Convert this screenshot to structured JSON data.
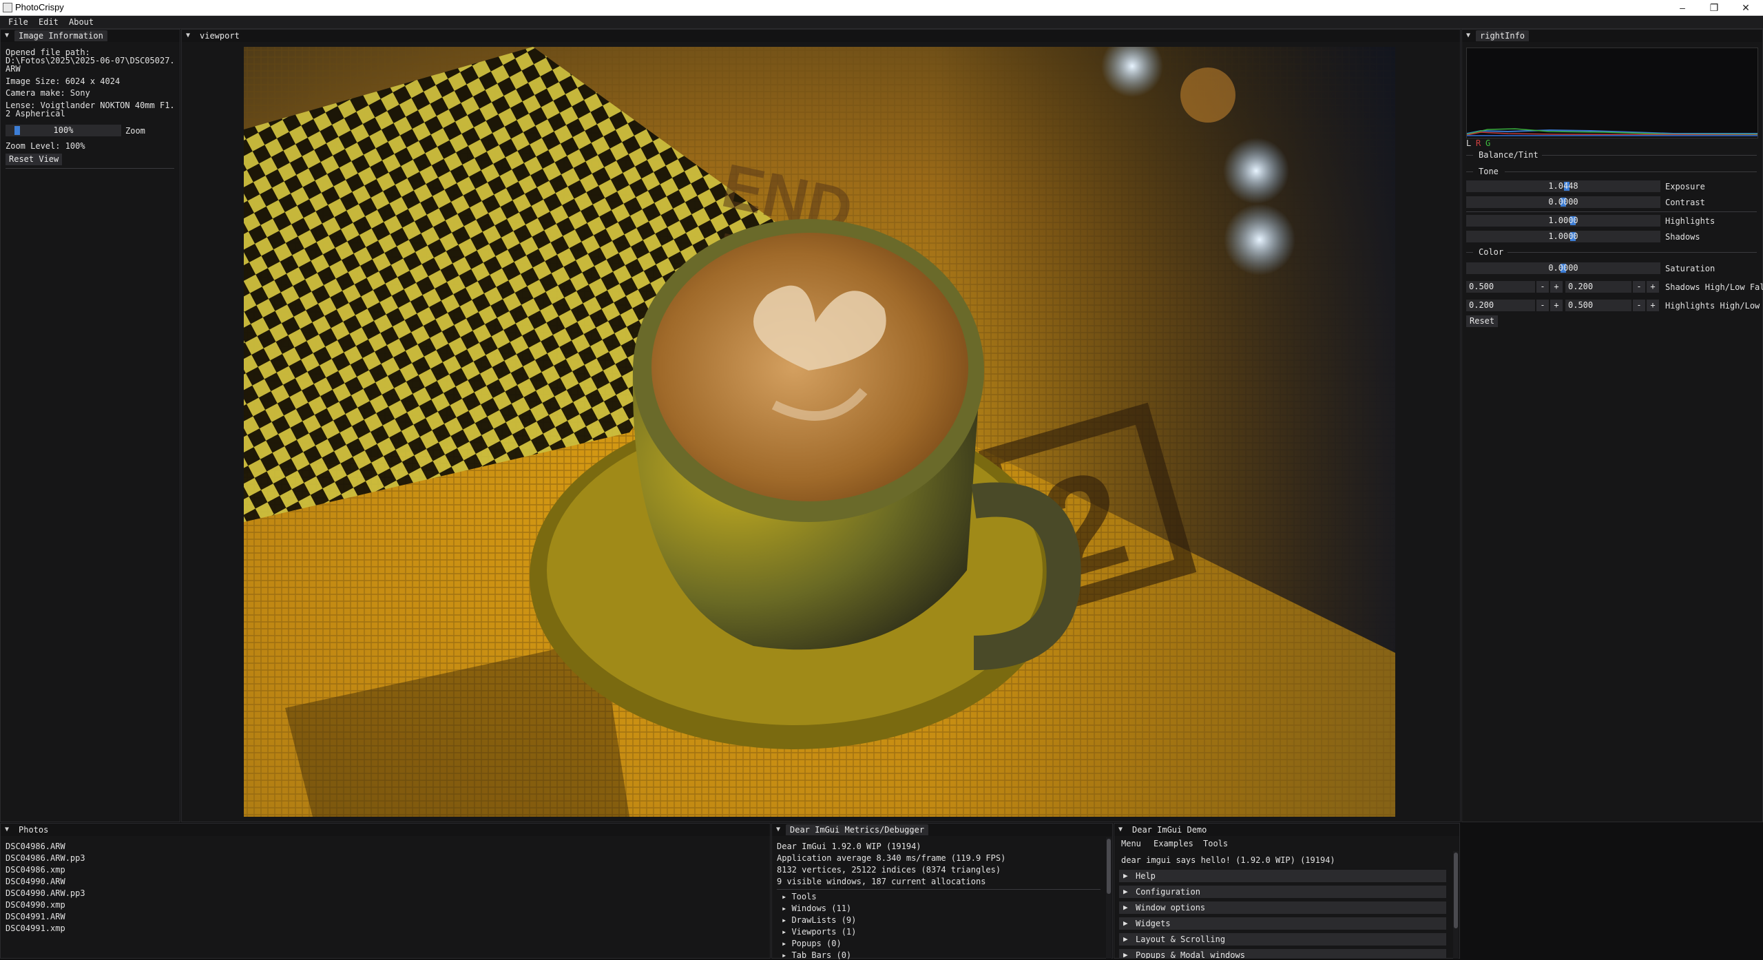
{
  "window": {
    "title": "PhotoCrispy",
    "minimize": "–",
    "restore": "❐",
    "close": "✕"
  },
  "menu": {
    "file": "File",
    "edit": "Edit",
    "about": "About"
  },
  "image_info": {
    "tab": "Image Information",
    "opened_label": "Opened file path:",
    "path_line1": "D:\\Fotos\\2025\\2025-06-07\\DSC05027.",
    "path_line2": "ARW",
    "image_size": "Image Size: 6024 x 4024",
    "camera_make": "Camera make: Sony",
    "lense_line1": "Lense: Voigtlander NOKTON 40mm F1.",
    "lense_line2": "2 Aspherical",
    "zoom_slider_value": "100%",
    "zoom_slider_fraction": 0.08,
    "zoom_label": "Zoom",
    "zoom_level": "Zoom Level: 100%",
    "reset_view": "Reset View"
  },
  "viewport": {
    "tab": "viewport"
  },
  "right_info": {
    "tab": "rightInfo",
    "histogram_legend": {
      "l": "L",
      "r": "R",
      "g": "G"
    },
    "balance_tint": "Balance/Tint",
    "tone_header": "Tone",
    "exposure": {
      "value": "1.0448",
      "label": "Exposure",
      "fraction": 0.52
    },
    "contrast": {
      "value": "0.0000",
      "label": "Contrast",
      "fraction": 0.5
    },
    "highlights": {
      "value": "1.0000",
      "label": "Highlights",
      "fraction": 0.55
    },
    "shadows": {
      "value": "1.0000",
      "label": "Shadows",
      "fraction": 0.55
    },
    "color_header": "Color",
    "saturation": {
      "value": "0.0000",
      "label": "Saturation",
      "fraction": 0.5
    },
    "shadows_hl": {
      "a": "0.500",
      "b": "0.200",
      "label": "Shadows High/Low Fal"
    },
    "highlights_hl": {
      "a": "0.200",
      "b": "0.500",
      "label": "Highlights High/Low"
    },
    "minus": "-",
    "plus": "+",
    "reset": "Reset"
  },
  "photos": {
    "tab": "Photos",
    "files": [
      "DSC04986.ARW",
      "DSC04986.ARW.pp3",
      "DSC04986.xmp",
      "DSC04990.ARW",
      "DSC04990.ARW.pp3",
      "DSC04990.xmp",
      "DSC04991.ARW",
      "DSC04991.xmp"
    ]
  },
  "metrics": {
    "tab": "Dear ImGui Metrics/Debugger",
    "line1": "Dear ImGui 1.92.0 WIP (19194)",
    "line2": "Application average 8.340 ms/frame (119.9 FPS)",
    "line3": "8132 vertices, 25122 indices (8374 triangles)",
    "line4": "9 visible windows, 187 current allocations",
    "items": [
      "Tools",
      "Windows (11)",
      "DrawLists (9)",
      "Viewports (1)",
      "Popups (0)",
      "Tab Bars (0)"
    ]
  },
  "demo": {
    "tab": "Dear ImGui Demo",
    "menu": [
      "Menu",
      "Examples",
      "Tools"
    ],
    "hello": "dear imgui says hello! (1.92.0 WIP) (19194)",
    "headers": [
      "Help",
      "Configuration",
      "Window options",
      "Widgets",
      "Layout & Scrolling",
      "Popups & Modal windows"
    ]
  },
  "colors": {
    "accent": "#3d7ed6",
    "panel_bg": "#161617",
    "frame_bg": "#2a2a2d"
  }
}
